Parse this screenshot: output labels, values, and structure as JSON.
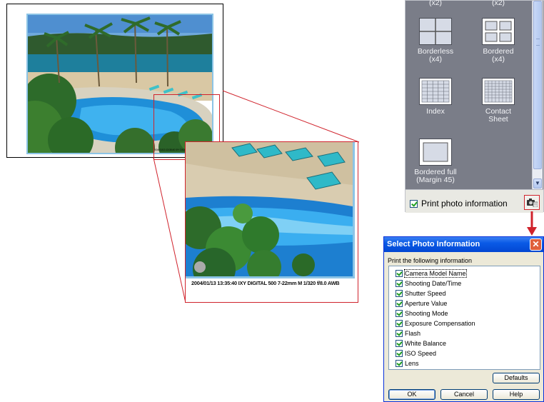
{
  "preview": {
    "photo_info_small": "2004/01/13 13:35:40 IXY DIGITAL 500 7-22mm M 1/320 f/8.0 AWB",
    "photo_info_large": "2004/01/13 13:35:40 IXY DIGITAL 500 7-22mm M 1/320 f/8.0 AWB"
  },
  "layout_panel": {
    "top_partial_labels": [
      "(x2)",
      "(x2)"
    ],
    "items": [
      {
        "label": "Borderless\n(x4)",
        "icon": "grid-2x2-borderless-icon"
      },
      {
        "label": "Bordered\n(x4)",
        "icon": "grid-2x2-bordered-icon"
      },
      {
        "label": "Index",
        "icon": "index-grid-icon"
      },
      {
        "label": "Contact\nSheet",
        "icon": "contact-sheet-icon"
      },
      {
        "label": "Bordered full\n(Margin 45)",
        "icon": "bordered-full-icon"
      }
    ],
    "print_photo_information_label": "Print photo information",
    "print_photo_information_checked": true
  },
  "dialog": {
    "title": "Select Photo Information",
    "prompt": "Print the following information",
    "items": [
      {
        "label": "Camera Model Name",
        "checked": true
      },
      {
        "label": "Shooting Date/Time",
        "checked": true
      },
      {
        "label": "Shutter Speed",
        "checked": true
      },
      {
        "label": "Aperture Value",
        "checked": true
      },
      {
        "label": "Shooting Mode",
        "checked": true
      },
      {
        "label": "Exposure Compensation",
        "checked": true
      },
      {
        "label": "Flash",
        "checked": true
      },
      {
        "label": "White Balance",
        "checked": true
      },
      {
        "label": "ISO Speed",
        "checked": true
      },
      {
        "label": "Lens",
        "checked": true
      }
    ],
    "defaults_label": "Defaults",
    "ok_label": "OK",
    "cancel_label": "Cancel",
    "help_label": "Help"
  },
  "colors": {
    "highlight_red": "#d0232c",
    "panel_gray": "#7a7d88",
    "dialog_title_blue": "#0a5ae6",
    "photo_border": "#8cc4e6"
  }
}
